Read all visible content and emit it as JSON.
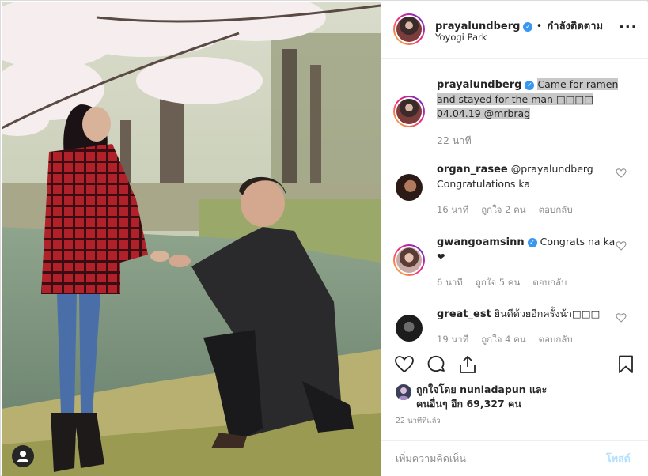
{
  "header": {
    "username": "prayalundberg",
    "separator": "•",
    "follow_label": "กำลังติดตาม",
    "location": "Yoyogi Park"
  },
  "comments": [
    {
      "username": "prayalundberg",
      "verified": true,
      "text": "Came for ramen and stayed for the man □□□□ 04.04.19 @mrbrag",
      "time": "22 นาที"
    },
    {
      "username": "organ_rasee",
      "text": "@prayalundberg Congratulations ka",
      "time": "16 นาที",
      "likes": "ถูกใจ 2 คน",
      "reply": "ตอบกลับ"
    },
    {
      "username": "gwangoamsinn",
      "verified": true,
      "text": "Congrats na ka❤",
      "time": "6 นาที",
      "likes": "ถูกใจ 5 คน",
      "reply": "ตอบกลับ"
    },
    {
      "username": "great_est",
      "text": "ยินดีด้วยอีกครั้งน้า□□□",
      "time": "19 นาที",
      "likes": "ถูกใจ 4 คน",
      "reply": "ตอบกลับ"
    }
  ],
  "likes_summary": {
    "line1": "ถูกใจโดย nunladapun และ",
    "line2": "คนอื่นๆ อีก 69,327 คน"
  },
  "time_ago": "22 นาทีที่แล้ว",
  "comment_box": {
    "placeholder": "เพิ่มความคิดเห็น",
    "post_label": "โพสต์"
  },
  "icons": [
    "more-icon",
    "heart-icon",
    "comment-icon",
    "share-icon",
    "bookmark-icon",
    "verified-icon",
    "user-tag-icon"
  ],
  "colors": {
    "verified": "#3897f0",
    "muted": "#8e8e8e",
    "post_disabled": "#b2dffc",
    "text": "#262626"
  }
}
